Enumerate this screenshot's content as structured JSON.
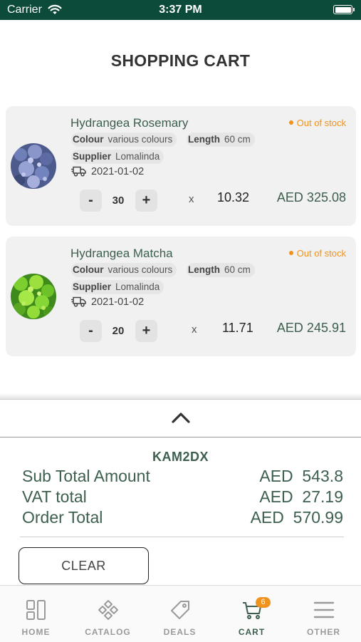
{
  "status_bar": {
    "carrier": "Carrier",
    "time": "3:37 PM"
  },
  "page_title": "SHOPPING CART",
  "items": [
    {
      "name": "Hydrangea Rosemary",
      "stock_status": "Out of stock",
      "colour_label": "Colour",
      "colour_value": "various colours",
      "length_label": "Length",
      "length_value": "60 cm",
      "supplier_label": "Supplier",
      "supplier_value": "Lomalinda",
      "delivery_date": "2021-01-02",
      "quantity": "30",
      "times_symbol": "x",
      "unit_price": "10.32",
      "line_total": "AED 325.08"
    },
    {
      "name": "Hydrangea Matcha",
      "stock_status": "Out of stock",
      "colour_label": "Colour",
      "colour_value": "various colours",
      "length_label": "Length",
      "length_value": "60 cm",
      "supplier_label": "Supplier",
      "supplier_value": "Lomalinda",
      "delivery_date": "2021-01-02",
      "quantity": "20",
      "times_symbol": "x",
      "unit_price": "11.71",
      "line_total": "AED 245.91"
    }
  ],
  "controls": {
    "minus": "-",
    "plus": "+"
  },
  "summary": {
    "promo_code": "KAM2DX",
    "subtotal_label": "Sub Total Amount",
    "subtotal_value": "AED  543.8",
    "vat_label": "VAT total",
    "vat_value": "AED  27.19",
    "order_total_label": "Order Total",
    "order_total_value": "AED  570.99",
    "clear_label": "CLEAR"
  },
  "tabs": {
    "home": "HOME",
    "catalog": "CATALOG",
    "deals": "DEALS",
    "cart": "CART",
    "other": "OTHER",
    "cart_badge": "6"
  },
  "colors": {
    "accent_green": "#3d5f4e",
    "status_bar": "#0c4a3a",
    "stock_orange": "#f0921e"
  },
  "icons": [
    "wifi-icon",
    "battery-icon",
    "truck-icon",
    "chevron-up-icon",
    "home-grid-icon",
    "catalog-flower-icon",
    "deals-tag-icon",
    "cart-icon",
    "menu-icon"
  ]
}
